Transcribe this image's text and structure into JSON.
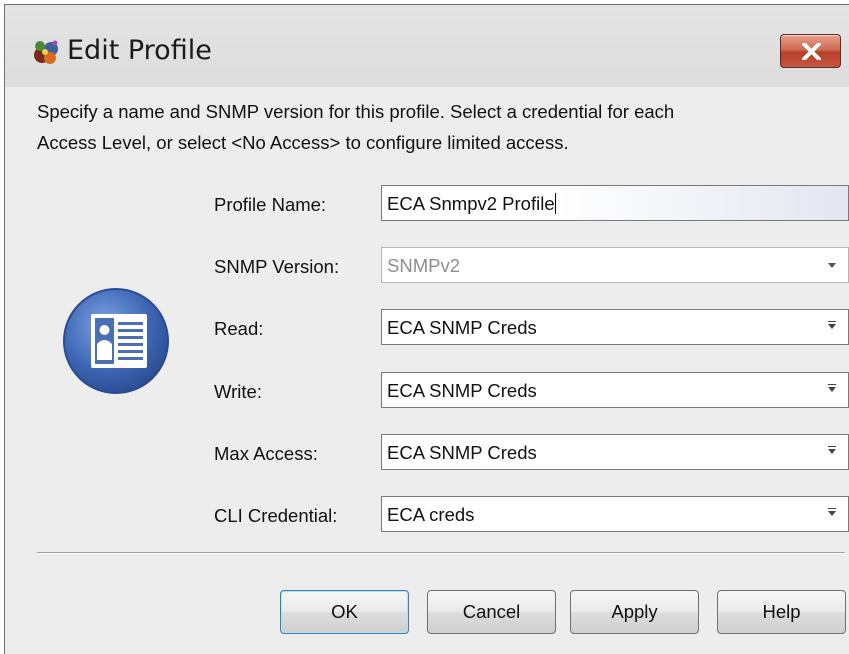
{
  "window": {
    "title": "Edit Profile",
    "title_icon": "app-icon",
    "close_icon": "close-icon"
  },
  "instructions": {
    "line1": "Specify a name and SNMP version for this profile.  Select a credential for each",
    "line2": "Access Level, or select <No Access> to configure limited access."
  },
  "form": {
    "profile_name": {
      "label": "Profile Name:",
      "value": "ECA Snmpv2 Profile"
    },
    "snmp_version": {
      "label": "SNMP Version:",
      "value": "SNMPv2",
      "enabled": false
    },
    "read": {
      "label": "Read:",
      "value": "ECA SNMP Creds"
    },
    "write": {
      "label": "Write:",
      "value": "ECA SNMP Creds"
    },
    "max_access": {
      "label": "Max Access:",
      "value": "ECA SNMP Creds"
    },
    "cli_credential": {
      "label": "CLI Credential:",
      "value": "ECA creds"
    }
  },
  "profile_icon": "profile-card-icon",
  "buttons": {
    "ok": "OK",
    "cancel": "Cancel",
    "apply": "Apply",
    "help": "Help"
  },
  "colors": {
    "dialog_bg": "#ededed",
    "close_button": "#c75640",
    "profile_icon_blue": "#3f67b5"
  }
}
